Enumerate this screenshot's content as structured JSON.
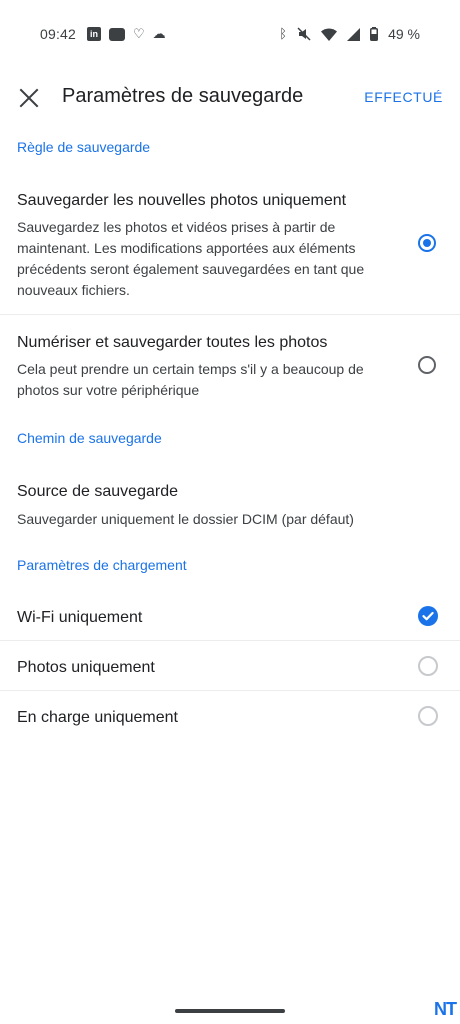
{
  "status_bar": {
    "time": "09:42",
    "battery": "49 %",
    "left_icons": [
      "linkedin-icon",
      "teams-icon",
      "health-icon",
      "cloud-icon"
    ],
    "right_icons": [
      "bluetooth-icon",
      "mute-icon",
      "wifi-icon",
      "signal-icon",
      "battery-icon"
    ]
  },
  "app_bar": {
    "title": "Paramètres de sauvegarde",
    "done_label": "EFFECTUÉ"
  },
  "sections": {
    "backup_rule": {
      "header": "Règle de sauvegarde",
      "option_new": {
        "title": "Sauvegarder les nouvelles photos uniquement",
        "desc": "Sauvegardez les photos et vidéos prises à partir de maintenant. Les modifications apportées aux éléments précédents seront également sauvegardées en tant que nouveaux fichiers.",
        "selected": true
      },
      "option_all": {
        "title": "Numériser et sauvegarder toutes les photos",
        "desc": "Cela peut prendre un certain temps s'il y a beaucoup de photos sur votre périphérique",
        "selected": false
      }
    },
    "backup_path": {
      "header": "Chemin de sauvegarde",
      "source_title": "Source de sauvegarde",
      "source_desc": "Sauvegarder uniquement le dossier DCIM (par défaut)"
    },
    "upload_settings": {
      "header": "Paramètres de chargement",
      "wifi_only": {
        "label": "Wi-Fi uniquement",
        "checked": true
      },
      "photos_only": {
        "label": "Photos uniquement",
        "checked": false
      },
      "charging_only": {
        "label": "En charge uniquement",
        "checked": false
      }
    }
  },
  "watermark": "NT",
  "colors": {
    "accent": "#1a73e8",
    "text": "#202124",
    "secondary": "#3c4043"
  }
}
